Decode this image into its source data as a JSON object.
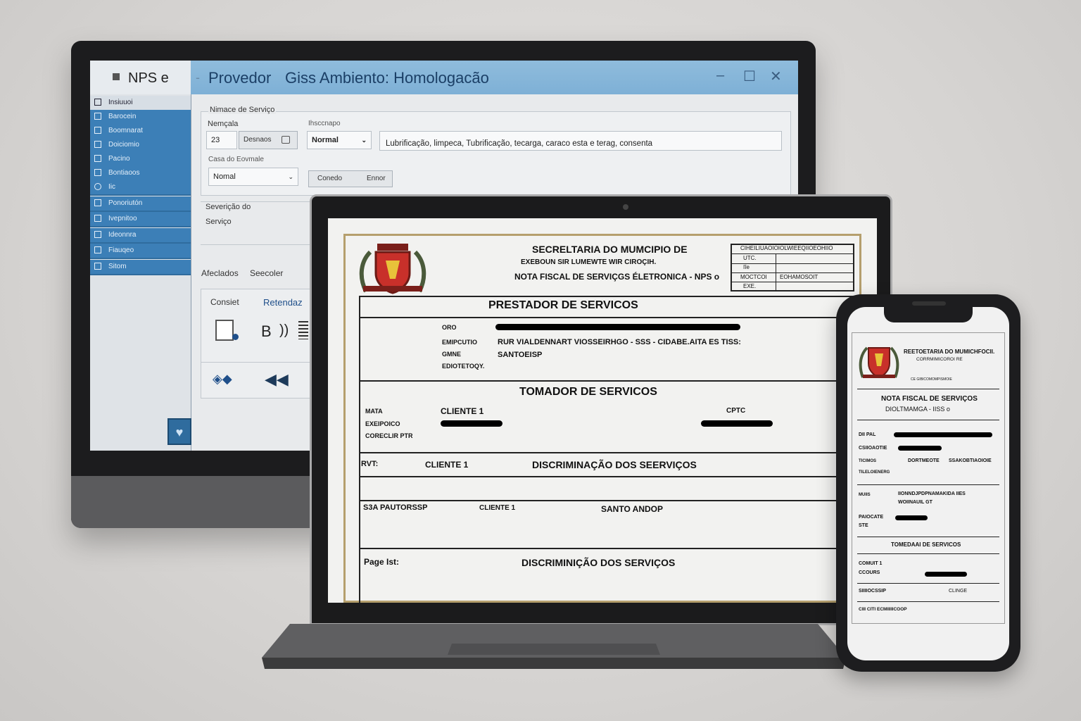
{
  "monitor": {
    "app_name": "NPS e",
    "title_separator": "-",
    "title_main": "Provedor",
    "title_env": "Giss Ambiento: Homologacão",
    "window_controls": {
      "minimize": "–",
      "maximize": "☐",
      "close": "✕"
    },
    "sidebar": {
      "items": [
        {
          "label": "Insiuuoi",
          "icon": "document-icon"
        },
        {
          "label": "Barocein",
          "icon": "list-icon"
        },
        {
          "label": "Boomnarat",
          "icon": "list-icon"
        },
        {
          "label": "Doiciomio",
          "icon": "list-icon"
        },
        {
          "label": "Pacino",
          "icon": "list-icon"
        },
        {
          "label": "Bontiaoos",
          "icon": "list-icon"
        },
        {
          "label": "Iic",
          "icon": "circle-icon"
        },
        {
          "label": "Ponoriutón",
          "icon": "list-icon"
        },
        {
          "label": "Ivepnitoo",
          "icon": "list-icon"
        },
        {
          "label": "Ideonnra",
          "icon": "list-icon"
        },
        {
          "label": "Fiauqeo",
          "icon": "list-icon"
        },
        {
          "label": "Sitom",
          "icon": "list-icon"
        }
      ],
      "heart_icon": "♥"
    },
    "form": {
      "section_title": "Nimace de Serviço",
      "number_label": "Nemçala",
      "number_value": "23",
      "desnaos_button": "Desnaos",
      "inscconapo_label": "Ihsccnapo",
      "inscconapo_value": "Normal",
      "description_value": "Lubrificação, limpeca, Tubrificação, tecarga, caraco esta e terag, consenta",
      "casa_label": "Casa do Eovmale",
      "casa_value": "Nomal",
      "btn_connedo": "Conedo",
      "btn_ennor": "Ennor",
      "severicao_label": "Severição do",
      "servico_label": "Serviço",
      "afeclados": "Afeclados",
      "seecoler": "Seecoler",
      "tab_consiet": "Consiet",
      "tab_retendaz": "Retendaz",
      "tool_b": "B",
      "tool_brackets": "))"
    }
  },
  "laptop_doc": {
    "header_line1": "SECRELTARIA DO MUMCIPIO DE",
    "header_line2": "EXEBOUN SIR LUMEWTE WIR CIROÇIH.",
    "header_line3": "NOTA FISCAL DE SERVIÇGS ÉLETRONICA - NPS o",
    "box_rows": [
      {
        "left": "CIHEILIUAOIOIOLWIEEQIIOEOHIIO",
        "right": ""
      },
      {
        "left": "UTC.",
        "right": ""
      },
      {
        "left": "Iîe",
        "right": ""
      },
      {
        "left": "MOCTCOI",
        "right": "EOHAMOSOIT"
      },
      {
        "left": "EXE.",
        "right": ""
      }
    ],
    "prestador_title": "PRESTADOR DE SERVICOS",
    "prest_labels": [
      "ORO",
      "EMIPCUTIO",
      "GMNE",
      "EDIOTETOQY."
    ],
    "prest_address": "RUR VIALDENNART VIOSSEIRHGO - SSS   -  CIDABE.AITA     ES TISS:",
    "prest_city": "SANTOEISP",
    "tomador_title": "TOMADOR DE SERVICOS",
    "tom_labels": [
      "MATA",
      "EXEIPOICO",
      "CORECLIR PTR"
    ],
    "tom_client": "CLIENTE 1",
    "tom_cptc": "CPTC",
    "rvt_label": "RVT:",
    "rvt_client": "CLIENTE 1",
    "discrim_1": "DISCRIMINAÇÃO DOS SEERVIÇOS",
    "row_s3a": "S3A PAUTORSSP",
    "row_client": "CLIENTE 1",
    "row_santo": "SANTO ANDOP",
    "page_list": "Page Ist:",
    "discrim_2": "DISCRIMINIÇÃO DOS SERVIÇOS"
  },
  "phone_doc": {
    "header_line1": "REETOETARIA DO MUMICHFOCII.",
    "header_line2": "CORRMIMICOROI   RE",
    "header_line3": "CE GIBICOMOMPISMOIE",
    "nota_title": "NOTA FISCAL DE SERVIÇOS",
    "nota_sub": "DIOLTMAMGA - IISS o",
    "rows": [
      {
        "label": "DII PAL"
      },
      {
        "label": "CSIIOAOTIE"
      },
      {
        "label": "TICIMOS",
        "mid": "DORTMEOTE",
        "right": "SSAKOBTIAOIOIE"
      },
      {
        "label": "TILELOIENERG"
      }
    ],
    "muis_label": "MUIIS",
    "muis_text": "IIONNDJPDPNAMAKIDA IIES",
    "muis_text2": "WOIINAUIL GT",
    "paucate": "PAIOCATE",
    "ste": "STE",
    "tomador": "TOMEDAAI DE SERVICOS",
    "comut": "COMUIT 1",
    "cours": "CCOURS",
    "snuocs": "SIIIIOCSSIP",
    "clinge": "CLINGE",
    "cili": "CIII CITI ECMIIIIICOOP"
  },
  "colors": {
    "sidebar_blue": "#3c7fb7",
    "titlebar_blue": "#8fbcdc",
    "gold_border": "#b59f6d",
    "seal_red": "#c8302a"
  }
}
